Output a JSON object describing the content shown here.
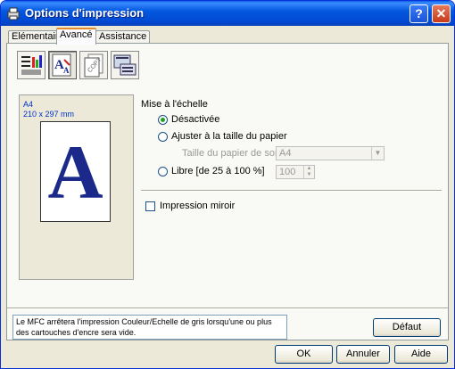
{
  "window": {
    "title": "Options d'impression",
    "help": "?",
    "close": "✕"
  },
  "tabs": [
    {
      "label": "Elémentaire"
    },
    {
      "label": "Avancé"
    },
    {
      "label": "Assistance"
    }
  ],
  "toolbar": {
    "tools": [
      "color-settings-icon",
      "scaling-icon",
      "copy-icon",
      "other-options-icon"
    ]
  },
  "preview": {
    "paper": "A4",
    "size": "210 x 297 mm",
    "letter": "A"
  },
  "scaling": {
    "title": "Mise à l'échelle",
    "off": "Désactivée",
    "fit": "Ajuster à la taille du papier",
    "output_label": "Taille du papier de sortie",
    "output_value": "A4",
    "free": "Libre [de 25 à 100 %]",
    "free_value": "100"
  },
  "mirror": {
    "label": "Impression miroir"
  },
  "info": "Le MFC arrêtera l'impression Couleur/Echelle de gris lorsqu'une ou plus des cartouches d'encre sera vide.",
  "buttons": {
    "default": "Défaut",
    "ok": "OK",
    "cancel": "Annuler",
    "help": "Aide"
  }
}
